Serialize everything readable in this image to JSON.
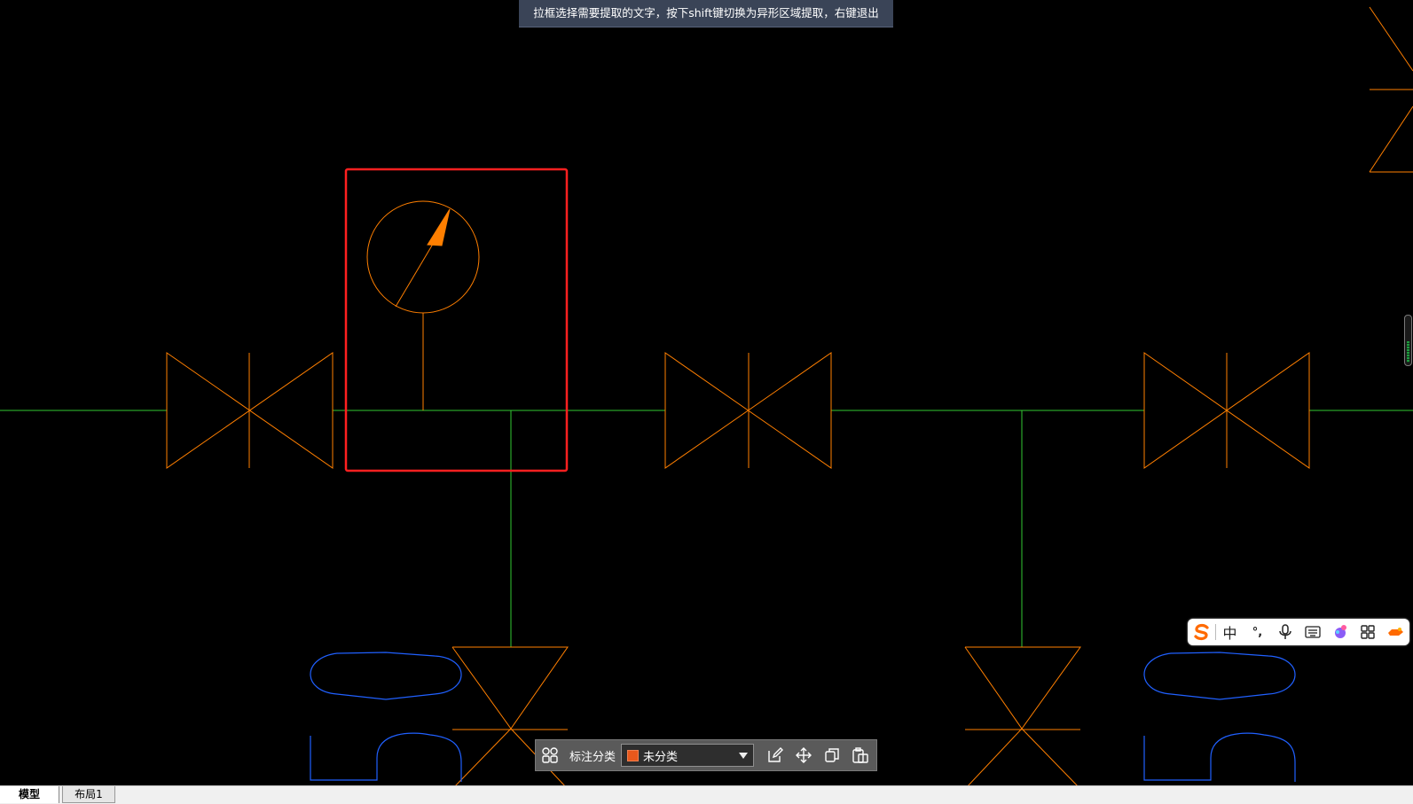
{
  "hint": {
    "text": "拉框选择需要提取的文字，按下shift键切换为异形区域提取，右键退出"
  },
  "toolbar": {
    "label": "标注分类",
    "category_value": "未分类",
    "category_color": "#e8581c"
  },
  "tabs": [
    {
      "label": "模型",
      "active": true
    },
    {
      "label": "布局1",
      "active": false
    }
  ],
  "ime": {
    "mode_label": "中",
    "punct_label": "°,",
    "icons": [
      "sogou-logo-icon",
      "microphone-icon",
      "keyboard-icon",
      "skin-icon",
      "grid-apps-icon",
      "toolbox-icon"
    ]
  },
  "colors": {
    "background": "#000000",
    "pipe": "#32c832",
    "valve": "#ff7f00",
    "fixture": "#2060ff",
    "selection": "#ff2020"
  }
}
